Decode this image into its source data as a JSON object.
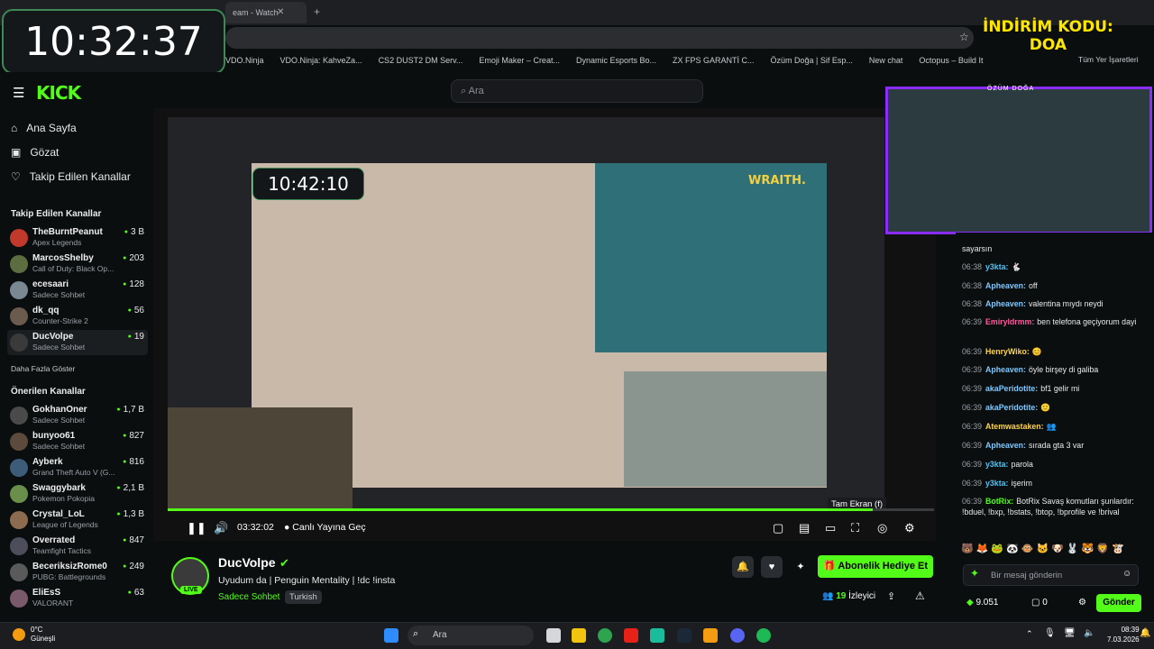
{
  "browser": {
    "tab_label": "eam - Watch",
    "bookmarks": [
      "VDO.Ninja",
      "VDO.Ninja: KahveZa...",
      "CS2 DUST2 DM Serv...",
      "Emoji Maker – Creat...",
      "Dynamic Esports Bo...",
      "ZX FPS GARANTİ C...",
      "Özüm Doğa | Sif Esp...",
      "New chat",
      "Octopus – Build It"
    ],
    "all_bookmarks": "Tüm Yer İşaretleri"
  },
  "overlay": {
    "clock": "10:32:37",
    "promo": "İNDİRİM KODU:\nDOA",
    "webcam_title": "ÖZÜM DOĞA"
  },
  "header": {
    "logo": "KICK",
    "search_placeholder": "Ara"
  },
  "sidebar": {
    "nav": [
      {
        "icon": "home-icon",
        "label": "Ana Sayfa"
      },
      {
        "icon": "compass-icon",
        "label": "Gözat"
      },
      {
        "icon": "heart-icon",
        "label": "Takip Edilen Kanallar"
      }
    ],
    "followed_title": "Takip Edilen Kanallar",
    "followed": [
      {
        "name": "TheBurntPeanut",
        "category": "Apex Legends",
        "viewers": "3 B"
      },
      {
        "name": "MarcosShelby",
        "category": "Call of Duty: Black Op...",
        "viewers": "203"
      },
      {
        "name": "ecesaari",
        "category": "Sadece Sohbet",
        "viewers": "128"
      },
      {
        "name": "dk_qq",
        "category": "Counter-Strike 2",
        "viewers": "56"
      },
      {
        "name": "DucVolpe",
        "category": "Sadece Sohbet",
        "viewers": "19"
      }
    ],
    "show_more": "Daha Fazla Göster",
    "recommended_title": "Önerilen Kanallar",
    "recommended": [
      {
        "name": "GokhanOner",
        "category": "Sadece Sohbet",
        "viewers": "1,7 B"
      },
      {
        "name": "bunyoo61",
        "category": "Sadece Sohbet",
        "viewers": "827"
      },
      {
        "name": "Ayberk",
        "category": "Grand Theft Auto V (G...",
        "viewers": "816"
      },
      {
        "name": "Swaggybark",
        "category": "Pokemon Pokopia",
        "viewers": "2,1 B"
      },
      {
        "name": "Crystal_LoL",
        "category": "League of Legends",
        "viewers": "1,3 B"
      },
      {
        "name": "Overrated",
        "category": "Teamfight Tactics",
        "viewers": "847"
      },
      {
        "name": "BeceriksizRome0",
        "category": "PUBG: Battlegrounds",
        "viewers": "249"
      },
      {
        "name": "EliEsS",
        "category": "VALORANT",
        "viewers": "63"
      }
    ]
  },
  "player": {
    "inner_clock": "10:42:10",
    "timecode": "03:32:02",
    "live_label": "Canlı Yayına Geç",
    "tooltip": "Tam Ekran (f)",
    "progress": 0.92
  },
  "stream": {
    "streamer": "DucVolpe",
    "live_badge": "LIVE",
    "title": "Uyudum da | Penguin Mentality | !dc !insta",
    "category": "Sadece Sohbet",
    "tag": "Turkish",
    "gift_label": "Abonelik Hediye Et",
    "viewers_count": "19",
    "viewers_label": "İzleyici"
  },
  "chat": {
    "top_fragment": "sayarsın",
    "messages": [
      {
        "time": "06:38",
        "user": "y3kta:",
        "text": "🐇",
        "color": "#4fc3f7"
      },
      {
        "time": "06:38",
        "user": "Apheaven:",
        "text": "off",
        "color": "#7ec8ff"
      },
      {
        "time": "06:38",
        "user": "Apheaven:",
        "text": "valentina mıydı neydi",
        "color": "#7ec8ff"
      },
      {
        "time": "06:39",
        "user": "Emiryldrmm:",
        "text": "ben telefona geçiyorum dayi",
        "color": "#ff5a9e"
      },
      {
        "time": "06:39",
        "user": "HenryWiko:",
        "text": "😊",
        "color": "#ffd54f"
      },
      {
        "time": "06:39",
        "user": "Apheaven:",
        "text": "öyle birşey di galiba",
        "color": "#7ec8ff"
      },
      {
        "time": "06:39",
        "user": "akaPeridotite:",
        "text": "bf1 gelir mi",
        "color": "#7ec8ff"
      },
      {
        "time": "06:39",
        "user": "akaPeridotite:",
        "text": "🙂",
        "color": "#7ec8ff"
      },
      {
        "time": "06:39",
        "user": "Atemwastaken:",
        "text": "👥",
        "color": "#ffd54f"
      },
      {
        "time": "06:39",
        "user": "Apheaven:",
        "text": "sırada gta 3 var",
        "color": "#7ec8ff"
      },
      {
        "time": "06:39",
        "user": "y3kta:",
        "text": "parola",
        "color": "#4fc3f7"
      },
      {
        "time": "06:39",
        "user": "y3kta:",
        "text": "işerim",
        "color": "#4fc3f7"
      },
      {
        "time": "06:39",
        "user": "BotRix:",
        "text": "BotRix Savaş komutları şunlardır: !bduel, !bxp, !bstats, !btop, !bprofile ve !brival",
        "color": "#53fc18"
      }
    ],
    "input_placeholder": "Bir mesaj gönderin",
    "points": "9.051",
    "zero": "0",
    "send_label": "Gönder"
  },
  "taskbar": {
    "weather_temp": "0°C",
    "weather_desc": "Güneşli",
    "search": "Ara",
    "time": "08:39",
    "date": "7.03.2026"
  },
  "colors": {
    "accent": "#53fc18",
    "webcam_border": "#8b2cff",
    "promo": "#ffe600"
  }
}
